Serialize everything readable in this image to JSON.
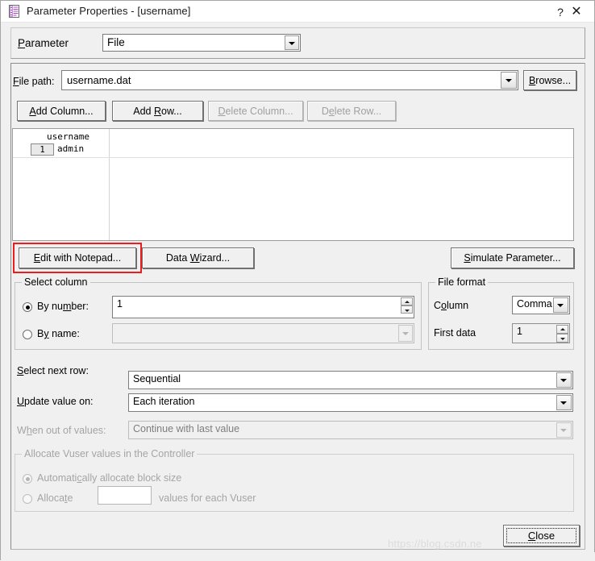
{
  "window": {
    "title": "Parameter Properties - [username]",
    "icon": "parameter-file-icon",
    "help_label": "?",
    "close_label": "✕"
  },
  "parameter_row": {
    "label": "Parameter",
    "label_prefix": "P",
    "value": "File"
  },
  "file_path": {
    "label": "File path:",
    "label_prefix": "F",
    "value": "username.dat",
    "browse_label": "Browse...",
    "browse_prefix": "B"
  },
  "grid_buttons": [
    {
      "name": "add-column",
      "label": "Add Column...",
      "prefix": "A",
      "enabled": true
    },
    {
      "name": "add-row",
      "label": "Add Row...",
      "prefix": "R",
      "enabled": true
    },
    {
      "name": "delete-column",
      "label": "Delete Column...",
      "prefix": "D",
      "enabled": false
    },
    {
      "name": "delete-row",
      "label": "Delete Row...",
      "prefix": "e",
      "enabled": false
    }
  ],
  "data_grid": {
    "columns": [
      "username"
    ],
    "rows": [
      {
        "number": "1",
        "cells": [
          "admin"
        ]
      }
    ]
  },
  "action_buttons": {
    "edit_notepad": "Edit with Notepad...",
    "data_wizard": "Data Wizard...",
    "simulate_parameter": "Simulate Parameter...",
    "highlight_color": "#ee1c1c",
    "highlighted": "edit-with-notepad-button"
  },
  "select_column": {
    "legend": "Select column",
    "by_number_label": "By number:",
    "by_number_value": "1",
    "by_number_selected": true,
    "by_name_label": "By name:",
    "by_name_value": "",
    "by_name_selected": false
  },
  "file_format": {
    "legend": "File format",
    "column_label": "Column",
    "column_value": "Comma",
    "first_data_label": "First data",
    "first_data_value": "1"
  },
  "row_settings": {
    "select_next_row_label": "Select next row:",
    "select_next_row_value": "Sequential",
    "update_value_on_label": "Update value on:",
    "update_value_on_value": "Each iteration",
    "when_out_of_values_label": "When out of values:",
    "when_out_of_values_value": "Continue with last value",
    "when_out_of_values_enabled": false
  },
  "allocate_group": {
    "legend": "Allocate Vuser values in the Controller",
    "enabled": false,
    "auto_label": "Automatically allocate block size",
    "auto_selected": true,
    "allocate_label": "Allocate",
    "allocate_value": "",
    "allocate_suffix": "values for each Vuser",
    "allocate_selected": false
  },
  "footer": {
    "close_label": "Close",
    "close_prefix": "C",
    "watermark": "https://blog.csdn.ne"
  }
}
